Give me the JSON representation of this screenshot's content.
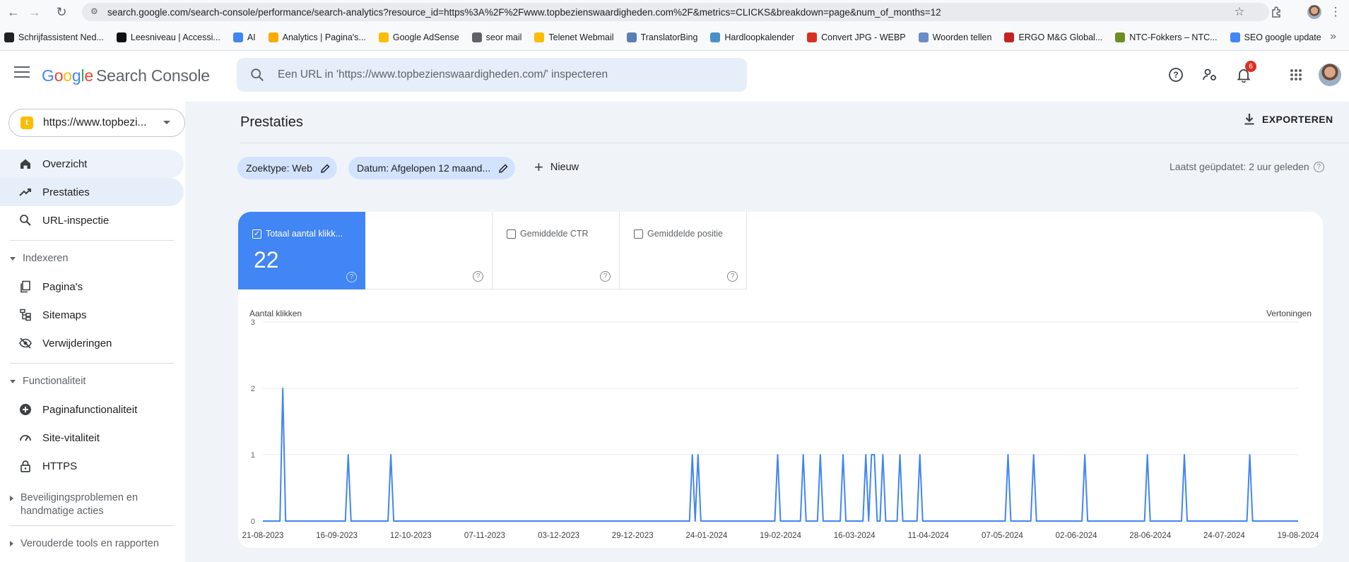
{
  "browser": {
    "url": "search.google.com/search-console/performance/search-analytics?resource_id=https%3A%2F%2Fwww.topbezienswaardigheden.com%2F&metrics=CLICKS&breakdown=page&num_of_months=12",
    "bookmarks": [
      {
        "label": "Schrijfassistent Ned...",
        "color": "#222222"
      },
      {
        "label": "Leesniveau | Accessi...",
        "color": "#111111"
      },
      {
        "label": "AI",
        "color": "#4285f4"
      },
      {
        "label": "Analytics | Pagina's...",
        "color": "#f9ab00"
      },
      {
        "label": "Google AdSense",
        "color": "#fbbc04"
      },
      {
        "label": "seor mail",
        "color": "#5f6368"
      },
      {
        "label": "Telenet Webmail",
        "color": "#fbbc04"
      },
      {
        "label": "TranslatorBing",
        "color": "#5b7fb5"
      },
      {
        "label": "Hardloopkalender",
        "color": "#4a90c8"
      },
      {
        "label": "Convert JPG - WEBP",
        "color": "#d93025"
      },
      {
        "label": "Woorden tellen",
        "color": "#6a8cc7"
      },
      {
        "label": "ERGO M&G Global...",
        "color": "#c5221f"
      },
      {
        "label": "NTC-Fokkers – NTC...",
        "color": "#6b8e23"
      },
      {
        "label": "SEO google update",
        "color": "#4285f4"
      }
    ]
  },
  "header": {
    "logo_google": "Google",
    "logo_product": "Search Console",
    "search_placeholder": "Een URL in 'https://www.topbezienswaardigheden.com/' inspecteren",
    "notification_count": "6"
  },
  "sidebar": {
    "property": "https://www.topbezi...",
    "property_initial": "t",
    "items": {
      "overview": "Overzicht",
      "performance": "Prestaties",
      "url_inspection": "URL-inspectie",
      "indexing": "Indexeren",
      "pages": "Pagina's",
      "sitemaps": "Sitemaps",
      "removals": "Verwijderingen",
      "features": "Functionaliteit",
      "page_features": "Paginafunctionaliteit",
      "site_vitals": "Site-vitaliteit",
      "https": "HTTPS",
      "security": "Beveiligingsproblemen en handmatige acties",
      "legacy": "Verouderde tools en rapporten"
    }
  },
  "main": {
    "title": "Prestaties",
    "export_label": "EXPORTEREN",
    "chip_search_type": "Zoektype: Web",
    "chip_date": "Datum: Afgelopen 12 maand...",
    "new_label": "Nieuw",
    "last_updated": "Laatst geüpdatet: 2 uur geleden",
    "metrics": {
      "clicks_label": "Totaal aantal klikk...",
      "clicks_value": "22",
      "ctr_label": "Gemiddelde CTR",
      "position_label": "Gemiddelde positie"
    }
  },
  "colors": {
    "accent": "#4285f4",
    "line": "#4285f4"
  },
  "chart_data": {
    "type": "line",
    "ylabel": "Aantal klikken",
    "y2label": "Vertoningen",
    "ylim": [
      0,
      3
    ],
    "yticks": [
      0,
      1,
      2,
      3
    ],
    "xticks": [
      "21-08-2023",
      "16-09-2023",
      "12-10-2023",
      "07-11-2023",
      "03-12-2023",
      "29-12-2023",
      "24-01-2024",
      "19-02-2024",
      "16-03-2024",
      "11-04-2024",
      "07-05-2024",
      "02-06-2024",
      "28-06-2024",
      "24-07-2024",
      "19-08-2024"
    ],
    "x_start": "2023-08-21",
    "x_end": "2024-08-19",
    "grid": true,
    "series": [
      {
        "points": [
          {
            "x": "2023-08-28",
            "y": 2
          },
          {
            "x": "2023-09-20",
            "y": 1
          },
          {
            "x": "2023-10-05",
            "y": 1
          },
          {
            "x": "2024-01-19",
            "y": 1
          },
          {
            "x": "2024-01-21",
            "y": 1
          },
          {
            "x": "2024-02-18",
            "y": 1
          },
          {
            "x": "2024-02-27",
            "y": 1
          },
          {
            "x": "2024-03-04",
            "y": 1
          },
          {
            "x": "2024-03-12",
            "y": 1
          },
          {
            "x": "2024-03-20",
            "y": 1
          },
          {
            "x": "2024-03-22",
            "y": 1
          },
          {
            "x": "2024-03-23",
            "y": 1
          },
          {
            "x": "2024-03-26",
            "y": 1
          },
          {
            "x": "2024-04-01",
            "y": 1
          },
          {
            "x": "2024-04-08",
            "y": 1
          },
          {
            "x": "2024-05-09",
            "y": 1
          },
          {
            "x": "2024-05-18",
            "y": 1
          },
          {
            "x": "2024-06-05",
            "y": 1
          },
          {
            "x": "2024-06-27",
            "y": 1
          },
          {
            "x": "2024-07-10",
            "y": 1
          },
          {
            "x": "2024-08-02",
            "y": 1
          }
        ]
      }
    ]
  }
}
